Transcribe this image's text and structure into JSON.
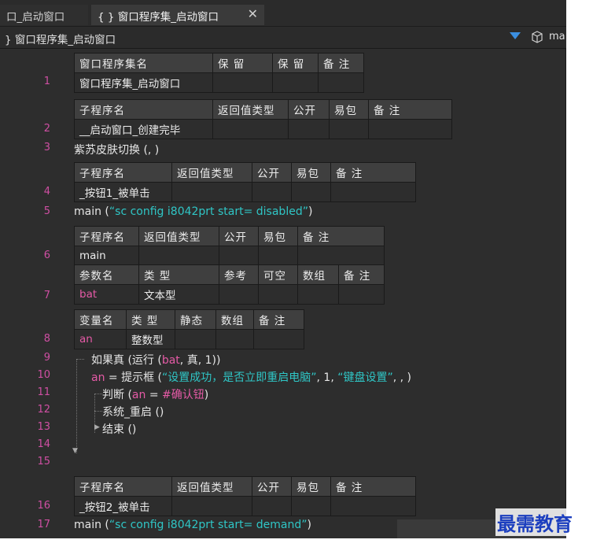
{
  "tabs": [
    {
      "label": "口_启动窗口"
    },
    {
      "label": "窗口程序集_启动窗口",
      "icon": "braces-icon"
    }
  ],
  "breadcrumb": {
    "label": "窗口程序集_启动窗口",
    "right_label": "ma"
  },
  "rows": {
    "t1": {
      "headers": [
        "窗口程序集名",
        "保 留",
        "保 留",
        "备 注"
      ],
      "values": [
        "窗口程序集_启动窗口",
        "",
        "",
        ""
      ]
    },
    "t2": {
      "headers": [
        "子程序名",
        "返回值类型",
        "公开",
        "易包",
        "备 注"
      ],
      "values": [
        "__启动窗口_创建完毕",
        "",
        "",
        "",
        ""
      ]
    },
    "t3": {
      "headers": [
        "子程序名",
        "返回值类型",
        "公开",
        "易包",
        "备 注"
      ],
      "values": [
        "_按钮1_被单击",
        "",
        "",
        "",
        ""
      ]
    },
    "t4": {
      "headers": [
        "子程序名",
        "返回值类型",
        "公开",
        "易包",
        "备 注"
      ],
      "values": [
        "main",
        "",
        "",
        "",
        ""
      ],
      "param_headers": [
        "参数名",
        "类 型",
        "参考",
        "可空",
        "数组",
        "备 注"
      ],
      "param_values": [
        "bat",
        "文本型",
        "",
        "",
        "",
        ""
      ]
    },
    "t5": {
      "headers": [
        "变量名",
        "类 型",
        "静态",
        "数组",
        "备 注"
      ],
      "values": [
        "an",
        "整数型",
        "",
        "",
        ""
      ]
    },
    "t6": {
      "headers": [
        "子程序名",
        "返回值类型",
        "公开",
        "易包",
        "备 注"
      ],
      "values": [
        "_按钮2_被单击",
        "",
        "",
        "",
        ""
      ]
    }
  },
  "line_numbers": [
    "1",
    "2",
    "3",
    "4",
    "5",
    "6",
    "7",
    "8",
    "9",
    "10",
    "11",
    "12",
    "13",
    "14",
    "15",
    "16",
    "17"
  ],
  "code": {
    "l3": "紫苏皮肤切换 (, )",
    "l5a": "main (",
    "l5s": "“sc config i8042prt start= disabled”",
    "l5b": ")",
    "l9a": "如果真 (运行 (",
    "l9v": "bat",
    "l9b": ", 真, 1))",
    "l10v": "an",
    "l10a": " = 提示框 (",
    "l10s1": "“设置成功，是否立即重启电脑”",
    "l10b": ", 1, ",
    "l10s2": "“键盘设置”",
    "l10c": ", , )",
    "l11a": "判断 (",
    "l11v": "an",
    "l11b": " = ",
    "l11s": "#确认钮",
    "l11c": ")",
    "l12": "系统_重启 ()",
    "l13": "结束 ()",
    "l17a": "main (",
    "l17s": "“sc config i8042prt start= demand”",
    "l17b": ")"
  },
  "watermark": "最需教育",
  "colors": {
    "line_number": "#cf4fa3",
    "string": "#2fc6c6",
    "variable": "#e55aa6",
    "accent": "#3b8fe0"
  }
}
